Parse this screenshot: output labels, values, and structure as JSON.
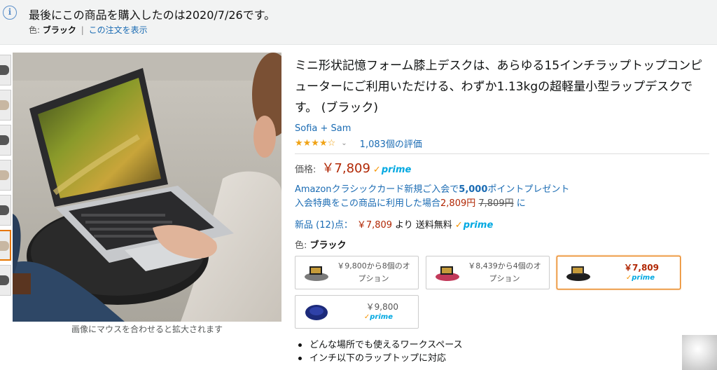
{
  "notice": {
    "title": "最後にこの商品を購入したのは2020/7/26です。",
    "color_label": "色:",
    "color_value": "ブラック",
    "separator": "|",
    "order_link": "この注文を表示",
    "icon": "info-icon"
  },
  "gallery": {
    "caption": "画像にマウスを合わせると拡大されます"
  },
  "product": {
    "title": "ミニ形状記憶フォーム膝上デスクは、あらゆる15インチラップトップコンピューターにご利用いただける、わずか1.13kgの超軽量小型ラップデスクです。 (ブラック)",
    "brand": "Sofia + Sam",
    "stars": "★★★★☆",
    "rating_value": 4.5,
    "rating_count": "1,083個の評価",
    "price_label": "価格:",
    "price": "￥7,809",
    "prime": "prime",
    "card_offer_line1_prefix": "Amazonクラシックカード新規ご入会で",
    "card_offer_points": "5,000",
    "card_offer_line1_suffix": "ポイントプレゼント",
    "card_offer_line2_prefix": "入会特典をこの商品に利用した場合",
    "card_offer_discounted": "2,809円",
    "card_offer_original": "7,809円",
    "card_offer_line2_suffix": "に",
    "new_label": "新品 (12)点：",
    "new_price": "￥7,809",
    "new_from": "より",
    "shipping": "送料無料",
    "color_label": "色:",
    "color_value": "ブラック"
  },
  "variants": [
    {
      "text": "￥9,800から8個のオプション",
      "price": "",
      "prime": ""
    },
    {
      "text": "￥8,439から4個のオプション",
      "price": "",
      "prime": ""
    },
    {
      "text": "",
      "price": "￥7,809",
      "prime": "prime",
      "selected": true
    },
    {
      "text": "",
      "price": "￥9,800",
      "prime": "prime"
    }
  ],
  "bullets": [
    "どんな場所でも使えるワークスペース",
    "インチ以下のラップトップに対応"
  ]
}
